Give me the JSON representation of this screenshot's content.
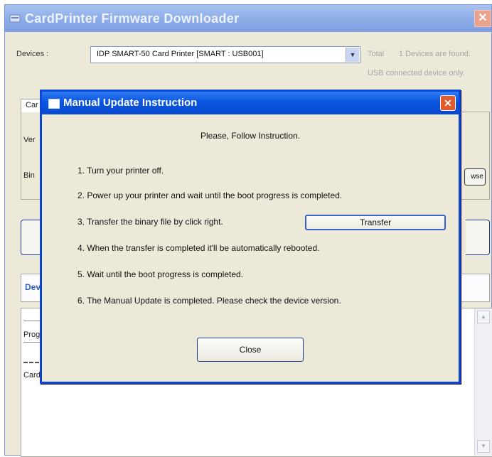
{
  "main_window": {
    "title": "CardPrinter Firmware Downloader",
    "close_glyph": "✕",
    "devices_label": "Devices :",
    "device_selected": "IDP SMART-50 Card Printer [SMART : USB001]",
    "dropdown_glyph": "▼",
    "total_label": "Total",
    "devices_found": "1 Devices are found.",
    "usb_note": "USB connected device only.",
    "tab_label": "Car",
    "version_label": "Ver",
    "binary_label": "Bin",
    "browse_label": "wse",
    "device_tab_label": "Dev",
    "log_progress_label": "Prog",
    "log_card_label": "Card",
    "scroll_up_glyph": "▲",
    "scroll_down_glyph": "▼"
  },
  "dialog": {
    "title": "Manual Update Instruction",
    "close_glyph": "✕",
    "heading": "Please, Follow Instruction.",
    "steps": [
      "1. Turn your printer off.",
      "2. Power up your printer and wait until the boot progress is completed.",
      "3. Transfer the binary file by click right.",
      "4. When the transfer is completed it'll be automatically rebooted.",
      "5. Wait until the boot progress is completed.",
      "6. The Manual Update is completed. Please check the device version."
    ],
    "transfer_button": "Transfer",
    "close_button": "Close"
  },
  "colors": {
    "dialog_titlebar": "#0a55e0",
    "main_titlebar": "#8eaee8",
    "window_bg": "#ece9d8",
    "close_red": "#e25b2e"
  }
}
